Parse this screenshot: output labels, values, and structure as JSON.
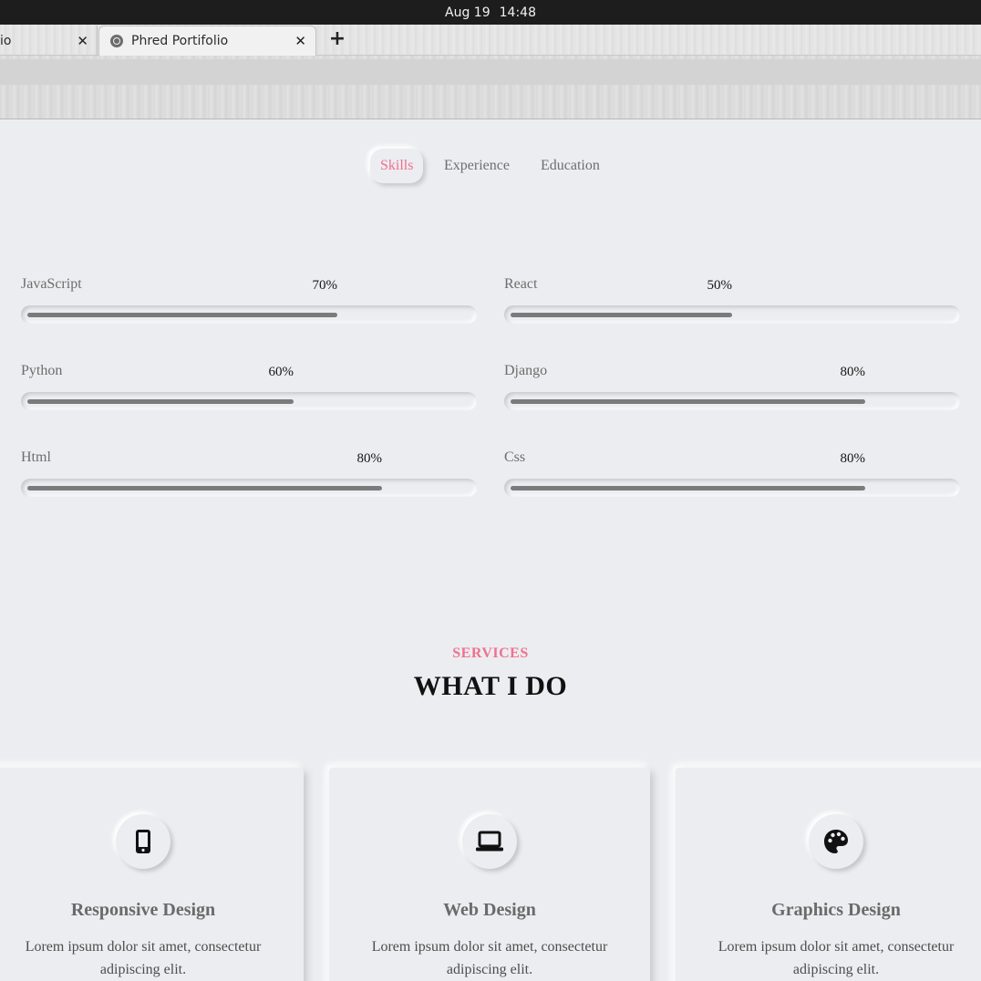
{
  "system_bar": {
    "date": "Aug 19",
    "time": "14:48"
  },
  "browser": {
    "tabs": [
      {
        "title": "io",
        "close": "✕"
      },
      {
        "title": "Phred Portifolio",
        "close": "✕"
      }
    ],
    "new_tab": "+"
  },
  "qualification": {
    "tabs": [
      "Skills",
      "Experience",
      "Education"
    ],
    "active_tab": "Skills"
  },
  "skills": [
    {
      "name": "JavaScript",
      "percent_label": "70%",
      "level": 0.7
    },
    {
      "name": "React",
      "percent_label": "50%",
      "level": 0.5
    },
    {
      "name": "Python",
      "percent_label": "60%",
      "level": 0.6
    },
    {
      "name": "Django",
      "percent_label": "80%",
      "level": 0.8
    },
    {
      "name": "Html",
      "percent_label": "80%",
      "level": 0.8
    },
    {
      "name": "Css",
      "percent_label": "80%",
      "level": 0.8
    }
  ],
  "services": {
    "kicker": "SERVICES",
    "title": "WHAT I DO",
    "cards": [
      {
        "icon": "mobile-icon",
        "name": "Responsive Design",
        "description": "Lorem ipsum dolor sit amet, consectetur adipiscing elit."
      },
      {
        "icon": "laptop-icon",
        "name": "Web Design",
        "description": "Lorem ipsum dolor sit amet, consectetur adipiscing elit."
      },
      {
        "icon": "palette-icon",
        "name": "Graphics Design",
        "description": "Lorem ipsum dolor sit amet, consectetur adipiscing elit."
      }
    ]
  },
  "colors": {
    "accent": "#f0708f",
    "background": "#ecedf0",
    "bar_fill": "#7b7b7b"
  }
}
